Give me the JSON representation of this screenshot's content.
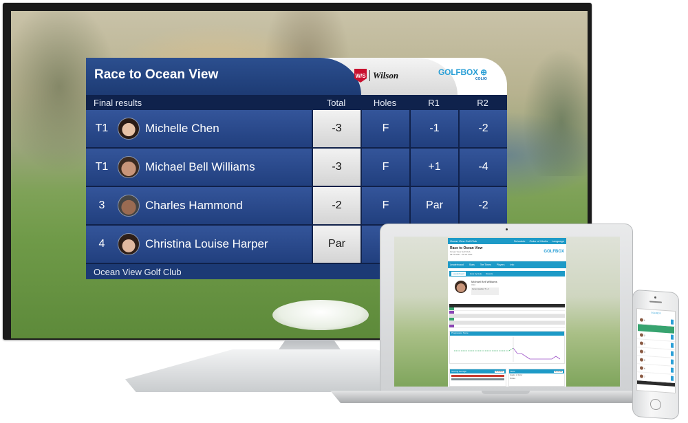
{
  "tv": {
    "leaderboard": {
      "title": "Race to Ocean View",
      "sponsor": {
        "badge": "W/S",
        "name": "Wilson"
      },
      "partner": {
        "name": "GOLFBOX",
        "sub": "COLIO"
      },
      "columns": {
        "label": "Final results",
        "total": "Total",
        "holes": "Holes",
        "r1": "R1",
        "r2": "R2"
      },
      "rows": [
        {
          "pos": "T1",
          "name": "Michelle Chen",
          "total": "-3",
          "holes": "F",
          "r1": "-1",
          "r2": "-2"
        },
        {
          "pos": "T1",
          "name": "Michael Bell Williams",
          "total": "-3",
          "holes": "F",
          "r1": "+1",
          "r2": "-4"
        },
        {
          "pos": "3",
          "name": "Charles Hammond",
          "total": "-2",
          "holes": "F",
          "r1": "Par",
          "r2": "-2"
        },
        {
          "pos": "4",
          "name": "Christina Louise Harper",
          "total": "Par",
          "holes": "",
          "r1": "",
          "r2": ""
        }
      ],
      "footer": "Ocean View Golf Club"
    }
  },
  "laptop": {
    "topbar": {
      "club": "Ocean View Golf Club",
      "nav": [
        "Schedule",
        "Order of Merits",
        "Language"
      ]
    },
    "header": {
      "title": "Race to Ocean View",
      "subtitle": "Ocean View Golf Club",
      "dates": "08.20.2021 - 08.22.2021",
      "brand": "GOLFBOX"
    },
    "tabs": [
      "Leaderboard",
      "Stats",
      "Tee Times",
      "Players",
      "Info"
    ],
    "subtabs": [
      "Leaderboard",
      "Hole by Hole",
      "Results"
    ],
    "player": {
      "name": "Michael Bell Williams",
      "country": "USA",
      "current_position_label": "Current position",
      "current_position": "T1",
      "to_par_label": "To Par",
      "to_par": "-3"
    },
    "progression_title": "Progression Score",
    "scoring_average": {
      "title": "Scoring Average",
      "filter": "All rounds",
      "rows": [
        "Player",
        "Field"
      ]
    },
    "stats": {
      "title": "Stats",
      "filter": "All rounds",
      "rows": [
        "Eagles or better",
        "Birdies"
      ]
    }
  },
  "phone": {
    "list": [
      "1",
      "2",
      "3",
      "4",
      "5",
      "6",
      "7"
    ]
  }
}
